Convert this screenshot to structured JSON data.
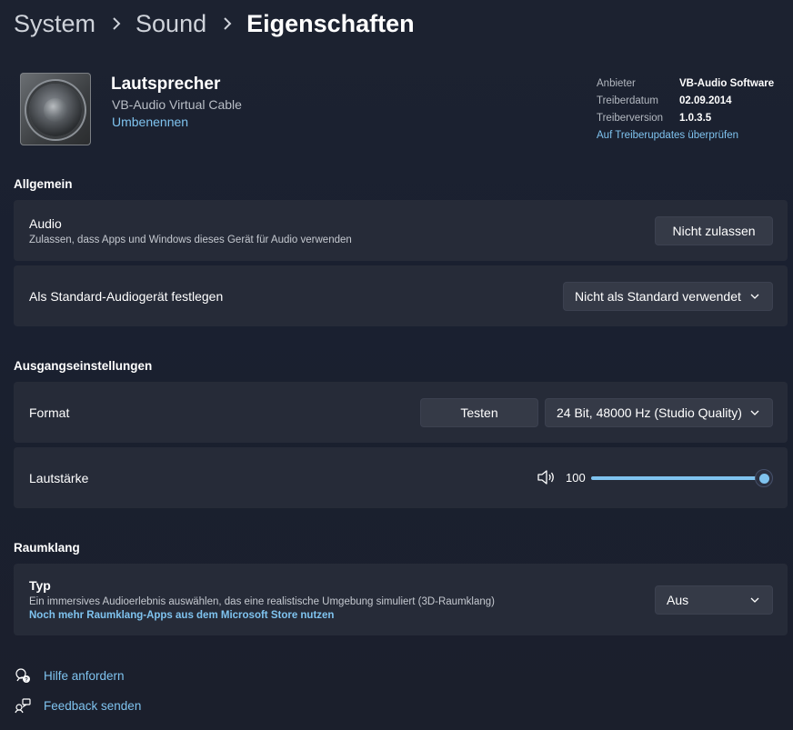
{
  "breadcrumb": {
    "items": [
      "System",
      "Sound",
      "Eigenschaften"
    ]
  },
  "device": {
    "name": "Lautsprecher",
    "subtitle": "VB-Audio Virtual Cable",
    "rename_link": "Umbenennen",
    "icon": "speaker-icon"
  },
  "driver_info": {
    "rows": [
      {
        "key": "Anbieter",
        "value": "VB-Audio Software"
      },
      {
        "key": "Treiberdatum",
        "value": "02.09.2014"
      },
      {
        "key": "Treiberversion",
        "value": "1.0.3.5"
      }
    ],
    "update_link": "Auf Treiberupdates überprüfen"
  },
  "general": {
    "title": "Allgemein",
    "audio": {
      "label": "Audio",
      "description": "Zulassen, dass Apps und Windows dieses Gerät für Audio verwenden",
      "button": "Nicht zulassen"
    },
    "default_device": {
      "label": "Als Standard-Audiogerät festlegen",
      "selected": "Nicht als Standard verwendet"
    }
  },
  "output": {
    "title": "Ausgangseinstellungen",
    "format": {
      "label": "Format",
      "test_button": "Testen",
      "selected": "24 Bit, 48000 Hz (Studio Quality)"
    },
    "volume": {
      "label": "Lautstärke",
      "value": "100",
      "fraction": 1.0
    }
  },
  "spatial": {
    "title": "Raumklang",
    "type": {
      "label": "Typ",
      "description": "Ein immersives Audioerlebnis auswählen, das eine realistische Umgebung simuliert (3D-Raumklang)",
      "store_link": "Noch mehr Raumklang-Apps aus dem Microsoft Store nutzen",
      "selected": "Aus"
    }
  },
  "footer": {
    "help": "Hilfe anfordern",
    "feedback": "Feedback senden"
  },
  "colors": {
    "accent": "#7fc3ef",
    "card": "#262b38",
    "control": "#353a47"
  }
}
